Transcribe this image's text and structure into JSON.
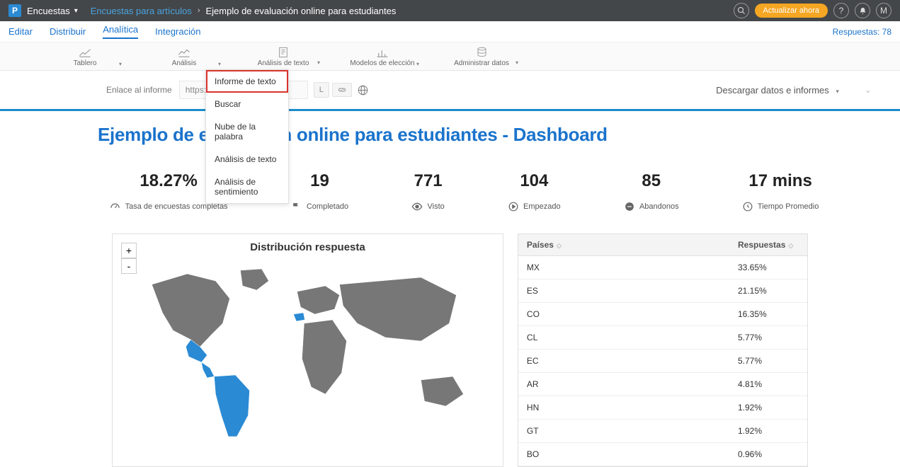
{
  "topbar": {
    "logo_letter": "P",
    "section": "Encuestas",
    "breadcrumb_link": "Encuestas para artículos",
    "breadcrumb_current": "Ejemplo de evaluación online para estudiantes",
    "update_btn": "Actualizar ahora"
  },
  "subnav": {
    "items": [
      "Editar",
      "Distribuir",
      "Analítica",
      "Integración"
    ],
    "active_index": 2,
    "responses_label": "Respuestas: 78"
  },
  "toolbar": {
    "tabs": [
      {
        "label": "Tablero"
      },
      {
        "label": "Análisis"
      },
      {
        "label": "Análisis de texto"
      },
      {
        "label": "Modelos de elección"
      },
      {
        "label": "Administrar datos"
      }
    ]
  },
  "dropdown": {
    "items": [
      "Informe de texto",
      "Buscar",
      "Nube de la palabra",
      "Análisis de texto",
      "Análisis de sentimiento"
    ],
    "highlighted_index": 0
  },
  "report_row": {
    "label": "Enlace al informe",
    "input_value": "https://w",
    "mini_btn": "L",
    "download_label": "Descargar datos e informes"
  },
  "dashboard": {
    "title": "Ejemplo de evaluación online para estudiantes - Dashboard"
  },
  "stats": [
    {
      "value": "18.27%",
      "label": "Tasa de encuestas completas",
      "icon": "gauge"
    },
    {
      "value": "19",
      "label": "Completado",
      "icon": "flag"
    },
    {
      "value": "771",
      "label": "Visto",
      "icon": "eye"
    },
    {
      "value": "104",
      "label": "Empezado",
      "icon": "play"
    },
    {
      "value": "85",
      "label": "Abandonos",
      "icon": "minus"
    },
    {
      "value": "17 mins",
      "label": "Tiempo Promedio",
      "icon": "clock"
    }
  ],
  "map": {
    "title": "Distribución respuesta",
    "zoom_in": "+",
    "zoom_out": "-"
  },
  "table": {
    "col1": "Países",
    "col2": "Respuestas",
    "rows": [
      {
        "country": "MX",
        "value": "33.65%"
      },
      {
        "country": "ES",
        "value": "21.15%"
      },
      {
        "country": "CO",
        "value": "16.35%"
      },
      {
        "country": "CL",
        "value": "5.77%"
      },
      {
        "country": "EC",
        "value": "5.77%"
      },
      {
        "country": "AR",
        "value": "4.81%"
      },
      {
        "country": "HN",
        "value": "1.92%"
      },
      {
        "country": "GT",
        "value": "1.92%"
      },
      {
        "country": "BO",
        "value": "0.96%"
      }
    ]
  },
  "chart_data": {
    "type": "table",
    "title": "Distribución respuesta",
    "categories": [
      "MX",
      "ES",
      "CO",
      "CL",
      "EC",
      "AR",
      "HN",
      "GT",
      "BO"
    ],
    "values": [
      33.65,
      21.15,
      16.35,
      5.77,
      5.77,
      4.81,
      1.92,
      1.92,
      0.96
    ],
    "unit": "percent",
    "xlabel": "Países",
    "ylabel": "Respuestas"
  }
}
